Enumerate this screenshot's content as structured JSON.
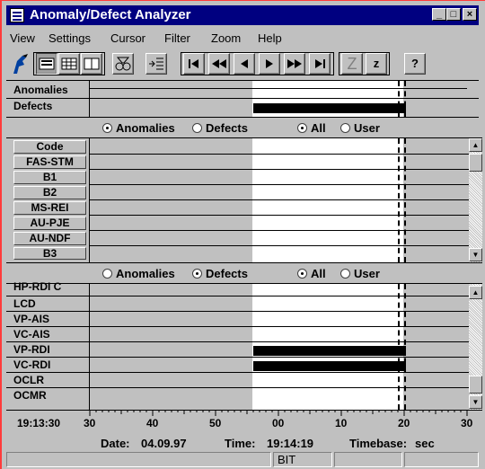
{
  "window": {
    "title": "Anomaly/Defect Analyzer",
    "controls": [
      "_",
      "□",
      "×"
    ]
  },
  "menu": [
    "View",
    "Settings",
    "Cursor",
    "Filter",
    "Zoom",
    "Help"
  ],
  "toolbar": {
    "z_disabled": "Z",
    "z_enabled": "z",
    "help": "?"
  },
  "top_panel": {
    "rows": [
      "Anomalies",
      "Defects"
    ]
  },
  "radio_top": {
    "anomalies": "Anomalies",
    "defects": "Defects",
    "all": "All",
    "user": "User",
    "selected_type": "Anomalies",
    "selected_scope": "All"
  },
  "middle_panel": {
    "rows": [
      "Code",
      "FAS-STM",
      "B1",
      "B2",
      "MS-REI",
      "AU-PJE",
      "AU-NDF",
      "B3"
    ]
  },
  "radio_mid": {
    "anomalies": "Anomalies",
    "defects": "Defects",
    "all": "All",
    "user": "User",
    "selected_type": "Defects",
    "selected_scope": "All"
  },
  "bottom_panel": {
    "rows": [
      "HP-RDI C",
      "LCD",
      "VP-AIS",
      "VC-AIS",
      "VP-RDI",
      "VC-RDI",
      "OCLR",
      "OCMR"
    ]
  },
  "axis": {
    "start_time": "19:13:30",
    "ticks": [
      "30",
      "40",
      "50",
      "00",
      "10",
      "20",
      "30"
    ]
  },
  "status": {
    "date_label": "Date:",
    "date": "04.09.97",
    "time_label": "Time:",
    "time": "19:14:19",
    "timebase_label": "Timebase:",
    "timebase": "sec",
    "mode": "BIT"
  }
}
